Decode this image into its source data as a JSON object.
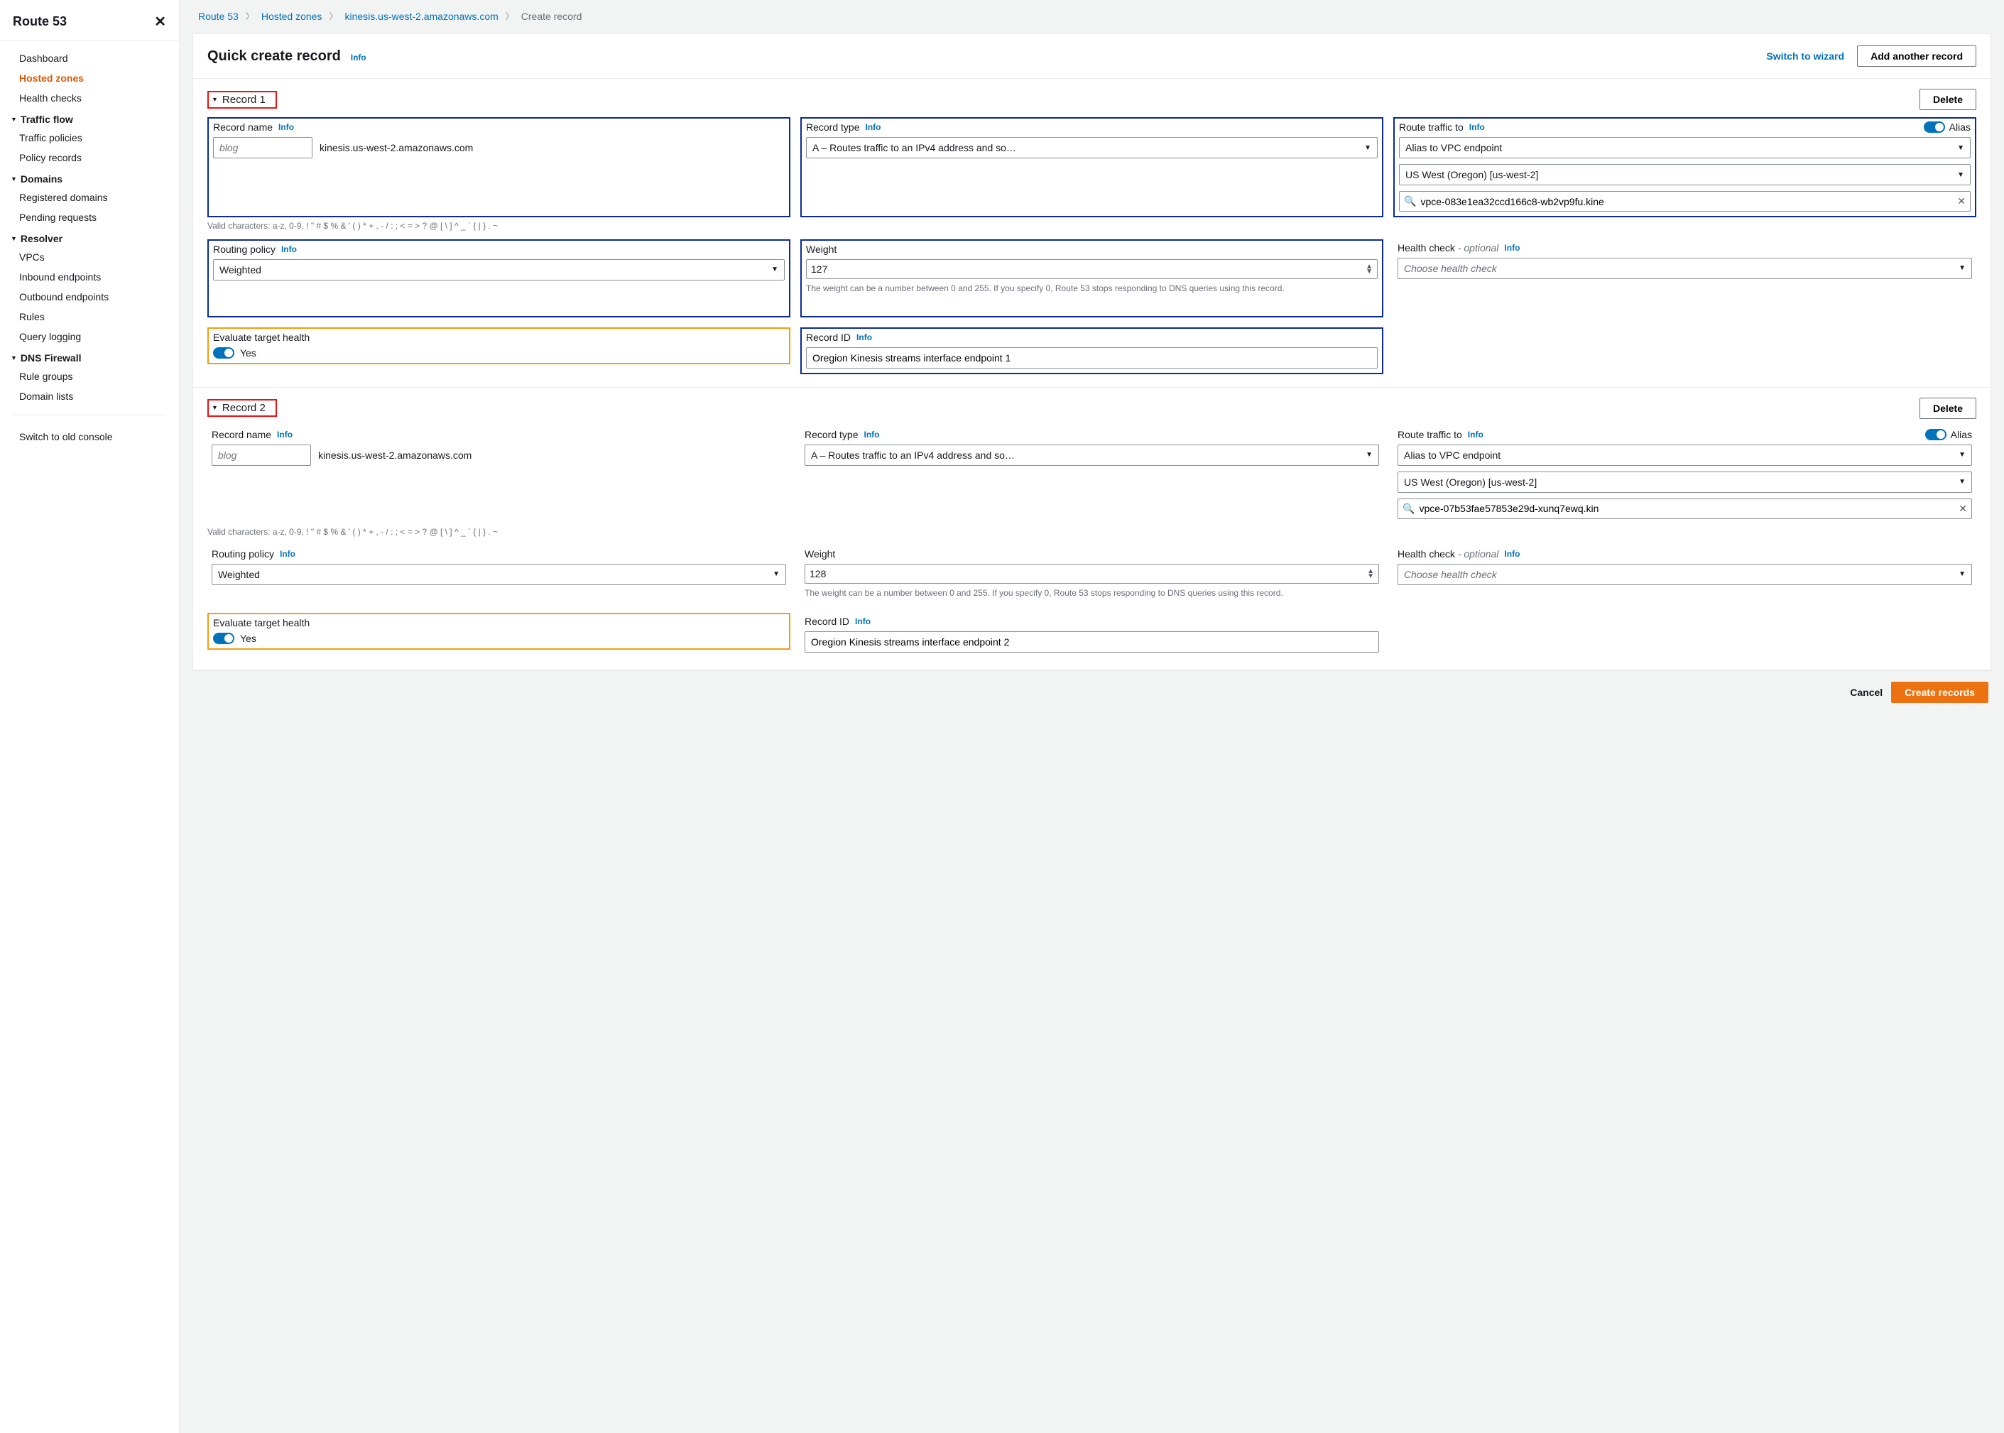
{
  "sidebar": {
    "title": "Route 53",
    "items_top": [
      {
        "label": "Dashboard",
        "active": false
      },
      {
        "label": "Hosted zones",
        "active": true
      },
      {
        "label": "Health checks",
        "active": false
      }
    ],
    "groups": [
      {
        "title": "Traffic flow",
        "items": [
          "Traffic policies",
          "Policy records"
        ]
      },
      {
        "title": "Domains",
        "items": [
          "Registered domains",
          "Pending requests"
        ]
      },
      {
        "title": "Resolver",
        "items": [
          "VPCs",
          "Inbound endpoints",
          "Outbound endpoints",
          "Rules",
          "Query logging"
        ]
      },
      {
        "title": "DNS Firewall",
        "items": [
          "Rule groups",
          "Domain lists"
        ]
      }
    ],
    "switch_old": "Switch to old console"
  },
  "breadcrumbs": {
    "items": [
      "Route 53",
      "Hosted zones",
      "kinesis.us-west-2.amazonaws.com"
    ],
    "current": "Create record"
  },
  "header": {
    "title": "Quick create record",
    "info": "Info",
    "switch_wizard": "Switch to wizard",
    "add_another": "Add another record"
  },
  "labels": {
    "record_name": "Record name",
    "record_type": "Record type",
    "route_traffic": "Route traffic to",
    "alias": "Alias",
    "routing_policy": "Routing policy",
    "weight": "Weight",
    "health_check": "Health check",
    "optional": "- optional",
    "evaluate_target": "Evaluate target health",
    "record_id": "Record ID",
    "delete": "Delete",
    "info": "Info",
    "yes": "Yes",
    "valid_chars": "Valid characters: a-z, 0-9, ! \" # $ % & ' ( ) * + , - / : ; < = > ? @ [ \\ ] ^ _ ` { | } . ~",
    "weight_hint": "The weight can be a number between 0 and 255. If you specify 0, Route 53 stops responding to DNS queries using this record.",
    "hc_placeholder": "Choose health check",
    "name_placeholder": "blog"
  },
  "records": [
    {
      "heading": "Record 1",
      "name": "",
      "suffix": "kinesis.us-west-2.amazonaws.com",
      "type": "A – Routes traffic to an IPv4 address and so…",
      "alias_on": true,
      "alias_target": "Alias to VPC endpoint",
      "alias_region": "US West (Oregon) [us-west-2]",
      "alias_search": "vpce-083e1ea32ccd166c8-wb2vp9fu.kine",
      "routing": "Weighted",
      "weight": "127",
      "health_check": "",
      "eval_target": true,
      "record_id": "Oregion Kinesis streams interface endpoint 1",
      "highlight_main": true
    },
    {
      "heading": "Record 2",
      "name": "",
      "suffix": "kinesis.us-west-2.amazonaws.com",
      "type": "A – Routes traffic to an IPv4 address and so…",
      "alias_on": true,
      "alias_target": "Alias to VPC endpoint",
      "alias_region": "US West (Oregon) [us-west-2]",
      "alias_search": "vpce-07b53fae57853e29d-xunq7ewq.kin",
      "routing": "Weighted",
      "weight": "128",
      "health_check": "",
      "eval_target": true,
      "record_id": "Oregion Kinesis streams interface endpoint 2",
      "highlight_main": false
    }
  ],
  "footer": {
    "cancel": "Cancel",
    "create": "Create records"
  }
}
